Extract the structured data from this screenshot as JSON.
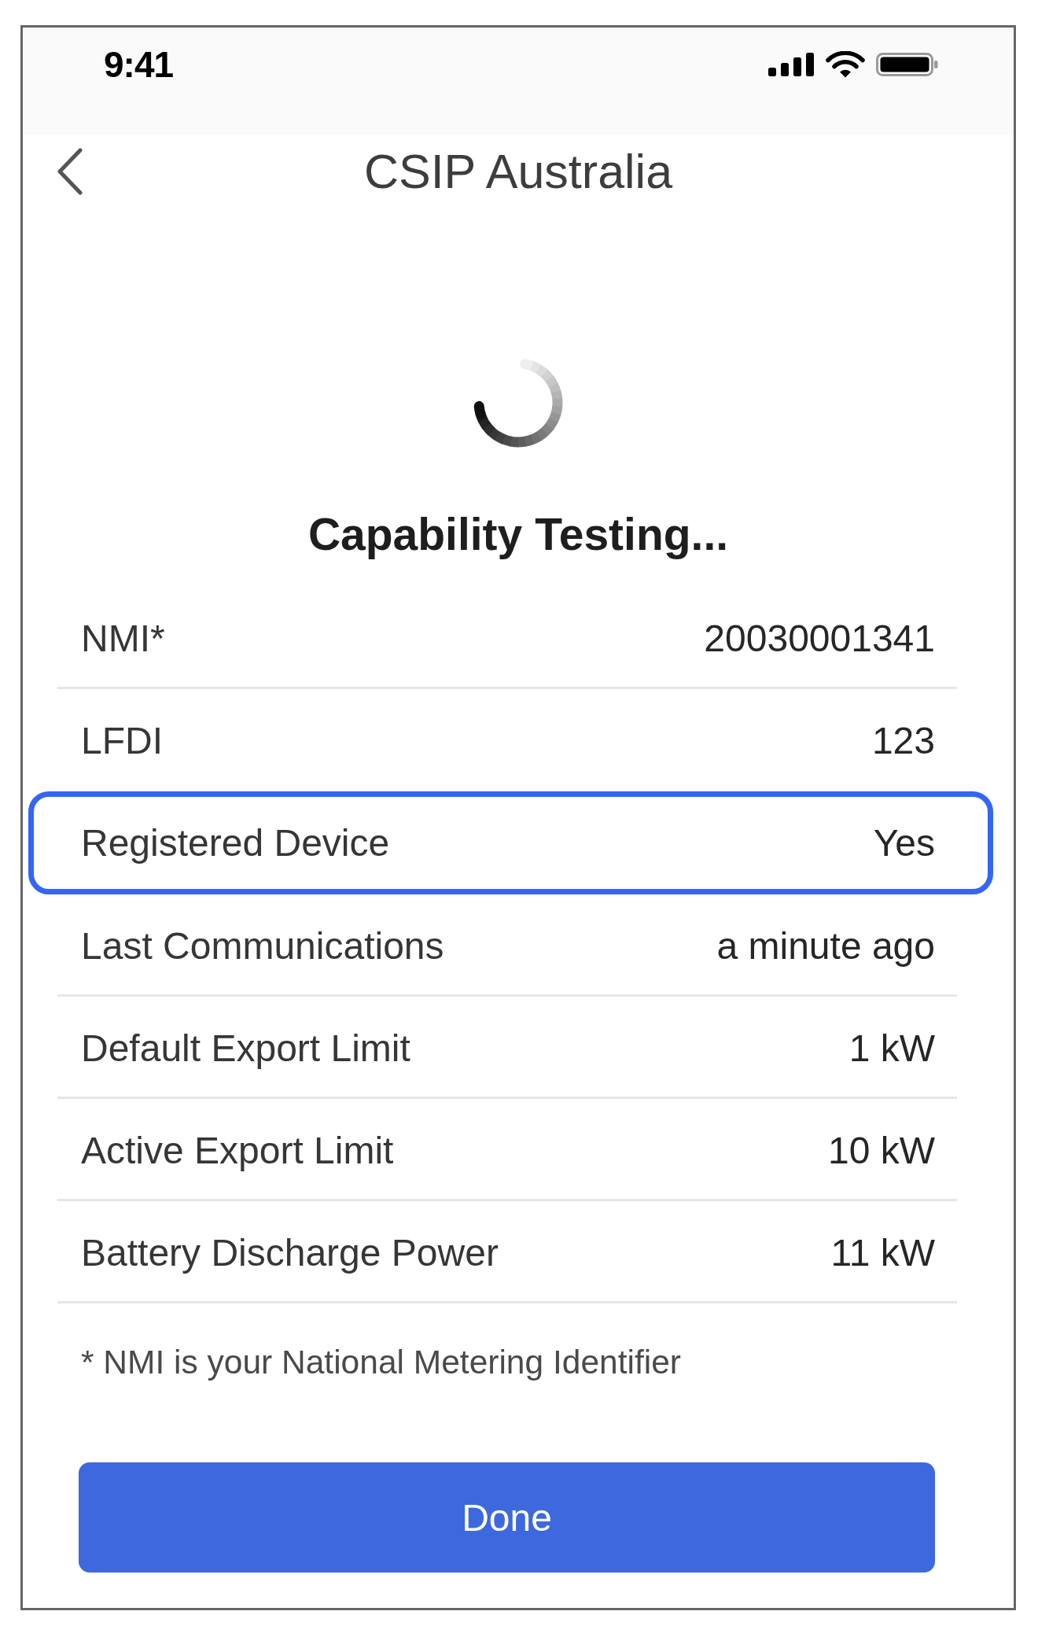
{
  "status_bar": {
    "time": "9:41"
  },
  "nav": {
    "title": "CSIP Australia"
  },
  "status": {
    "heading": "Capability Testing..."
  },
  "rows": [
    {
      "label": "NMI*",
      "value": "20030001341",
      "highlighted": false
    },
    {
      "label": "LFDI",
      "value": "123",
      "highlighted": false
    },
    {
      "label": "Registered Device",
      "value": "Yes",
      "highlighted": true
    },
    {
      "label": "Last Communications",
      "value": "a minute ago",
      "highlighted": false
    },
    {
      "label": "Default Export Limit",
      "value": "1 kW",
      "highlighted": false
    },
    {
      "label": "Active Export Limit",
      "value": "10 kW",
      "highlighted": false
    },
    {
      "label": "Battery Discharge Power",
      "value": "11 kW",
      "highlighted": false
    }
  ],
  "footnote": "* NMI is your National Metering Identifier",
  "button": {
    "label": "Done"
  }
}
